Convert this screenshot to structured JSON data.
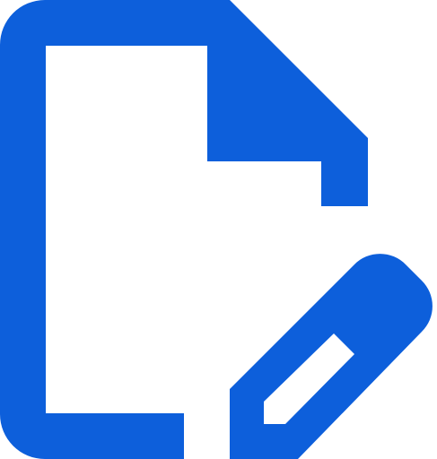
{
  "icon": {
    "name": "document-edit-icon",
    "color": "#0D5FDB",
    "background": "#FFFFFF"
  }
}
